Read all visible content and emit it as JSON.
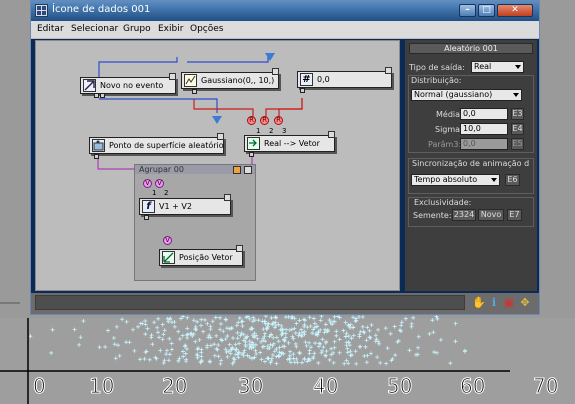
{
  "window": {
    "title": "Ícone de dados 001",
    "menu": [
      "Editar",
      "Selecionar",
      "Grupo",
      "Exibir",
      "Opções"
    ]
  },
  "nodes": {
    "novo_evento": "Novo no evento",
    "gaussiano": "Gaussiano(0,, 10,)",
    "hash_value": "0,0",
    "ponto_superficie": "Ponto de superfície aleatório",
    "real_vetor": "Real --> Vetor",
    "v1v2": "V1 + V2",
    "posicao_vetor": "Posição Vetor"
  },
  "port_labels": {
    "r_ports": [
      "R",
      "R",
      "R"
    ],
    "r_nums": [
      "1",
      "2",
      "3"
    ],
    "v_ports": [
      "V",
      "V"
    ],
    "v_nums": [
      "1",
      "2"
    ],
    "v_out": "V"
  },
  "group": {
    "title": "Agrupar 00"
  },
  "panel": {
    "title": "Aleatório 001",
    "tipo_label": "Tipo de saída:",
    "tipo_value": "Real",
    "distribuicao_label": "Distribuição:",
    "distribuicao_value": "Normal (gaussiano)",
    "media_label": "Média:",
    "media_value": "0,0",
    "media_btn": "E3",
    "sigma_label": "Sigma:",
    "sigma_value": "10,0",
    "sigma_btn": "E4",
    "param3_label": "Parâm3:",
    "param3_value": "0,0",
    "param3_btn": "E5",
    "sync_label": "Sincronização de animação d",
    "sync_value": "Tempo absoluto",
    "sync_btn": "E6",
    "excl_label": "Exclusividade:",
    "semente_label": "Semente:",
    "semente_value": "2324",
    "novo_btn": "Novo",
    "e7_btn": "E7"
  },
  "axis_labels": [
    "0",
    "10",
    "20",
    "30",
    "40",
    "50",
    "60",
    "70"
  ],
  "colors": {
    "viewport_bg": "#9a9a9a",
    "particle": "#c8f5ff",
    "wire_blue": "#2d4ed0",
    "wire_red": "#d01c1c",
    "wire_purple": "#b040b0"
  }
}
